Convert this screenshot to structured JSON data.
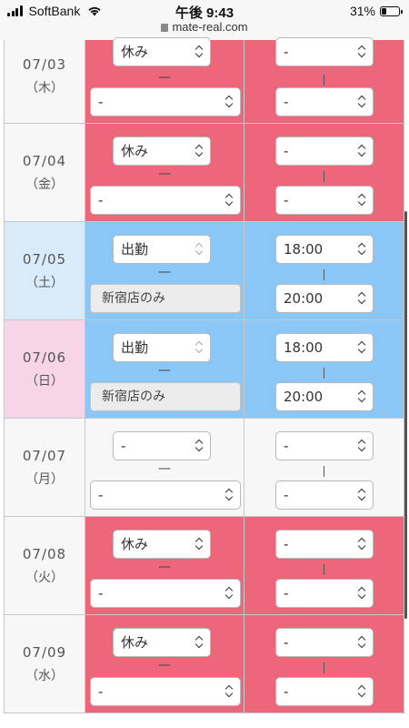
{
  "status": {
    "carrier": "SoftBank",
    "time": "午後 9:43",
    "url": "mate-real.com",
    "battery": "31%",
    "battery_level": 0.31
  },
  "schedule": [
    {
      "date": "07/03",
      "weekday": "（木）",
      "type": "休み",
      "shop": "-",
      "start": "-",
      "end": "-",
      "color": "#ed667a"
    },
    {
      "date": "07/04",
      "weekday": "（金）",
      "type": "休み",
      "shop": "-",
      "start": "-",
      "end": "-",
      "color": "#ed667a"
    },
    {
      "date": "07/05",
      "weekday": "（土）",
      "type": "出勤",
      "shop": "新宿店のみ",
      "start": "18:00",
      "end": "20:00",
      "color": "#8ac7f6"
    },
    {
      "date": "07/06",
      "weekday": "（日）",
      "type": "出勤",
      "shop": "新宿店のみ",
      "start": "18:00",
      "end": "20:00",
      "color": "#8ac7f6"
    },
    {
      "date": "07/07",
      "weekday": "（月）",
      "type": "-",
      "shop": "-",
      "start": "-",
      "end": "-",
      "color": "#f7f7f7"
    },
    {
      "date": "07/08",
      "weekday": "（火）",
      "type": "休み",
      "shop": "-",
      "start": "-",
      "end": "-",
      "color": "#ed667a"
    },
    {
      "date": "07/09",
      "weekday": "（水）",
      "type": "休み",
      "shop": "-",
      "start": "-",
      "end": "-",
      "color": "#ed667a"
    }
  ],
  "separators": {
    "dash": "—",
    "bar": "|"
  }
}
